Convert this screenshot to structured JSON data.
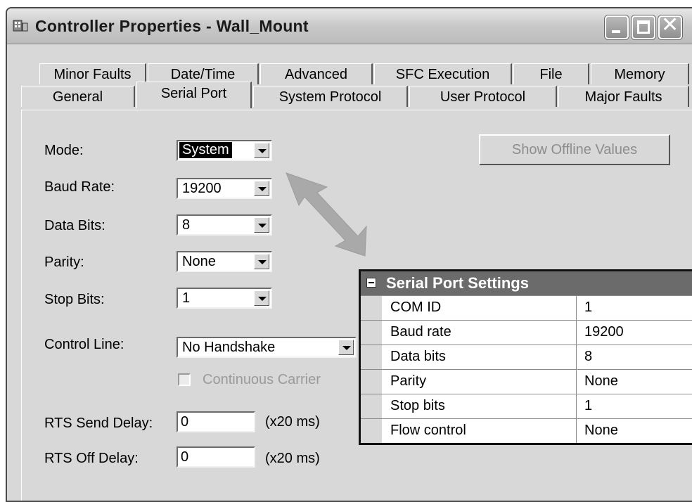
{
  "window": {
    "title": "Controller Properties - Wall_Mount"
  },
  "tabs_row_back": [
    {
      "label": "Minor Faults"
    },
    {
      "label": "Date/Time"
    },
    {
      "label": "Advanced"
    },
    {
      "label": "SFC Execution"
    },
    {
      "label": "File"
    },
    {
      "label": "Memory"
    }
  ],
  "tabs_row_front": [
    {
      "label": "General"
    },
    {
      "label": "Serial Port",
      "selected": true
    },
    {
      "label": "System Protocol"
    },
    {
      "label": "User Protocol"
    },
    {
      "label": "Major Faults"
    }
  ],
  "form": {
    "mode_label": "Mode:",
    "mode_value": "System",
    "baud_label": "Baud Rate:",
    "baud_value": "19200",
    "data_bits_label": "Data Bits:",
    "data_bits_value": "8",
    "parity_label": "Parity:",
    "parity_value": "None",
    "stop_bits_label": "Stop Bits:",
    "stop_bits_value": "1",
    "control_line_label": "Control Line:",
    "control_line_value": "No Handshake",
    "continuous_carrier_label": "Continuous Carrier",
    "rts_send_delay_label": "RTS Send Delay:",
    "rts_send_delay_value": "0",
    "rts_send_delay_unit": "(x20 ms)",
    "rts_off_delay_label": "RTS Off Delay:",
    "rts_off_delay_value": "0",
    "rts_off_delay_unit": "(x20 ms)",
    "show_offline_values": "Show Offline Values"
  },
  "settings_panel": {
    "header": "Serial Port Settings",
    "rows": [
      {
        "key": "COM ID",
        "value": "1"
      },
      {
        "key": "Baud rate",
        "value": "19200"
      },
      {
        "key": "Data bits",
        "value": "8"
      },
      {
        "key": "Parity",
        "value": "None"
      },
      {
        "key": "Stop bits",
        "value": "1"
      },
      {
        "key": "Flow control",
        "value": "None"
      }
    ]
  },
  "colors": {
    "dialog_bg": "#d8d8d8",
    "grid_header": "#6b6b6b",
    "arrow": "#a9a9a9"
  }
}
